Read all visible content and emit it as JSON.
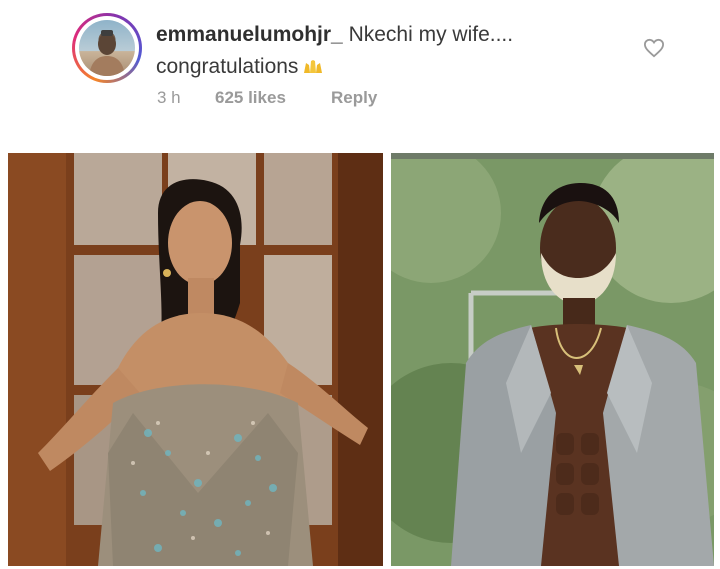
{
  "comment": {
    "username": "emmanuelumohjr_",
    "text_line1": "Nkechi my wife....",
    "text_line2": "congratulations",
    "time": "3 h",
    "likes": "625 likes",
    "reply_label": "Reply"
  }
}
